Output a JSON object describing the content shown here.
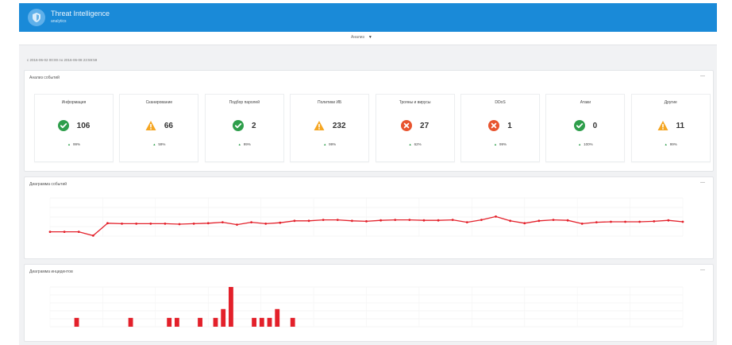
{
  "app": {
    "title": "Threat Intelligence",
    "subtitle": "analytics",
    "period": "Анализ",
    "date_range": "с 2016-06-02 00:00 по 2016-06-08 23:59:59"
  },
  "colors": {
    "header": "#1a8ad8",
    "ok": "#2e9e4b",
    "warning": "#f5a623",
    "error": "#e8542f",
    "series": "#e3202a"
  },
  "events_panel": {
    "title": "Анализ событий",
    "cards": [
      {
        "title": "Информация",
        "value": "106",
        "status": "ok",
        "icon": "check-circle-icon",
        "trend": "99%"
      },
      {
        "title": "Сканирование",
        "value": "66",
        "status": "warning",
        "icon": "warning-triangle-icon",
        "trend": "59%"
      },
      {
        "title": "Подбор паролей",
        "value": "2",
        "status": "ok",
        "icon": "check-circle-icon",
        "trend": "99%"
      },
      {
        "title": "Политики ИБ",
        "value": "232",
        "status": "warning",
        "icon": "warning-triangle-icon",
        "trend": "99%"
      },
      {
        "title": "Трояны и вирусы",
        "value": "27",
        "status": "error",
        "icon": "error-circle-icon",
        "trend": "62%"
      },
      {
        "title": "DDoS",
        "value": "1",
        "status": "error",
        "icon": "error-circle-icon",
        "trend": "99%"
      },
      {
        "title": "Атаки",
        "value": "0",
        "status": "ok",
        "icon": "check-circle-icon",
        "trend": "100%"
      },
      {
        "title": "Другие",
        "value": "11",
        "status": "warning",
        "icon": "warning-triangle-icon",
        "trend": "99%"
      }
    ]
  },
  "events_chart_panel": {
    "title": "Диаграмма событий"
  },
  "incidents_chart_panel": {
    "title": "Диаграмма инцидентов"
  },
  "chart_data": [
    {
      "type": "line",
      "title": "Диаграмма событий",
      "ylim": [
        0,
        4
      ],
      "grid": true,
      "values": [
        0.45,
        0.45,
        0.45,
        0.05,
        1.35,
        1.3,
        1.3,
        1.3,
        1.3,
        1.25,
        1.3,
        1.35,
        1.45,
        1.2,
        1.45,
        1.3,
        1.4,
        1.6,
        1.6,
        1.7,
        1.7,
        1.6,
        1.55,
        1.65,
        1.7,
        1.7,
        1.65,
        1.65,
        1.7,
        1.45,
        1.7,
        2.05,
        1.6,
        1.35,
        1.6,
        1.7,
        1.65,
        1.3,
        1.45,
        1.5,
        1.5,
        1.5,
        1.55,
        1.65,
        1.5
      ]
    },
    {
      "type": "bar",
      "title": "Диаграмма инцидентов",
      "ylim": [
        0,
        9
      ],
      "grid": true,
      "values": [
        0,
        0,
        0,
        2,
        0,
        0,
        0,
        0,
        0,
        0,
        2,
        0,
        0,
        0,
        0,
        2,
        2,
        0,
        0,
        2,
        0,
        2,
        4,
        9,
        0,
        0,
        2,
        2,
        2,
        4,
        0,
        2,
        0,
        0,
        0,
        0,
        0,
        0,
        0,
        0,
        0,
        0,
        0,
        0,
        0,
        0,
        0,
        0,
        0,
        0,
        0,
        0,
        0,
        0,
        0,
        0,
        0,
        0,
        0,
        0,
        0,
        0,
        0,
        0,
        0,
        0,
        0,
        0,
        0,
        0,
        0,
        0,
        0,
        0,
        0,
        0,
        0,
        0,
        0,
        0,
        0,
        0
      ]
    }
  ]
}
